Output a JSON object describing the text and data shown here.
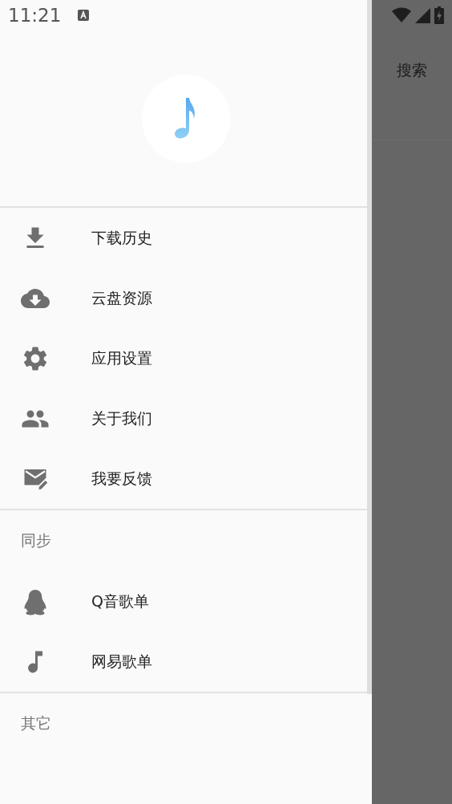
{
  "status_bar": {
    "time": "11:21"
  },
  "behind": {
    "search_label": "搜索"
  },
  "drawer": {
    "sections": [
      {
        "items": [
          {
            "label": "下载历史"
          },
          {
            "label": "云盘资源"
          },
          {
            "label": "应用设置"
          },
          {
            "label": "关于我们"
          },
          {
            "label": "我要反馈"
          }
        ]
      },
      {
        "header": "同步",
        "items": [
          {
            "label": "Q音歌单"
          },
          {
            "label": "网易歌单"
          }
        ]
      },
      {
        "header": "其它"
      }
    ]
  }
}
